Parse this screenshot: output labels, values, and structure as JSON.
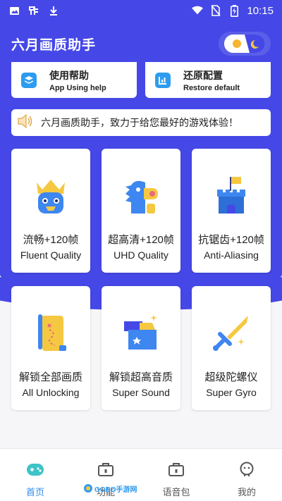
{
  "status_bar": {
    "time": "10:15",
    "icons": [
      "image-icon",
      "app-icon",
      "download-icon",
      "wifi-icon",
      "no-sim-icon",
      "battery-charging-icon"
    ]
  },
  "header": {
    "title": "六月画质助手",
    "toggle_icon": "day-night-toggle-icon"
  },
  "top_cards": [
    {
      "title": "使用帮助",
      "subtitle": "App Using help",
      "icon": "help-icon"
    },
    {
      "title": "还原配置",
      "subtitle": "Restore default",
      "icon": "restore-icon"
    }
  ],
  "notice": {
    "icon": "speaker-icon",
    "text": "六月画质助手，致力于给您最好的游戏体验！"
  },
  "features": [
    {
      "zh": "流畅+120帧",
      "en": "Fluent Quality",
      "icon": "crown-face-icon"
    },
    {
      "zh": "超高清+120帧",
      "en": "UHD Quality",
      "icon": "dino-icon"
    },
    {
      "zh": "抗锯齿+120帧",
      "en": "Anti-Aliasing",
      "icon": "castle-icon"
    },
    {
      "zh": "解锁全部画质",
      "en": "All Unlocking",
      "icon": "scroll-map-icon"
    },
    {
      "zh": "解锁超高音质",
      "en": "Super Sound",
      "icon": "treasure-box-icon"
    },
    {
      "zh": "超级陀螺仪",
      "en": "Super Gyro",
      "icon": "sword-icon"
    }
  ],
  "tabbar": [
    {
      "label": "首页",
      "icon": "gamepad-icon",
      "active": true
    },
    {
      "label": "功能",
      "icon": "toolbox-icon",
      "active": false
    },
    {
      "label": "语音包",
      "icon": "briefcase-icon",
      "active": false
    },
    {
      "label": "我的",
      "icon": "profile-icon",
      "active": false
    }
  ],
  "watermark": {
    "text": "GOBO手游网"
  },
  "colors": {
    "primary": "#4548e6",
    "accent": "#2d8cf0",
    "background": "#f6f6f8"
  }
}
